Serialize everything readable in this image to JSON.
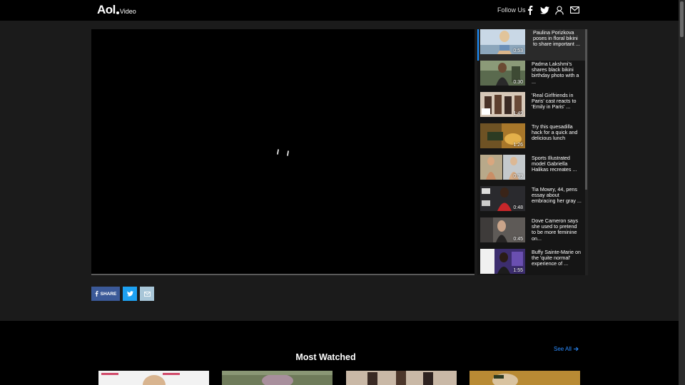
{
  "header": {
    "logo_main": "Aol",
    "logo_sub": "Video",
    "follow_label": "Follow Us"
  },
  "playlist": [
    {
      "title": "Paulina Porizkova poses in floral bikini to share important ...",
      "duration": "0:53",
      "active": true
    },
    {
      "title": "Padma Lakshmi's shares black bikini birthday photo with a ...",
      "duration": "0:30"
    },
    {
      "title": "'Real Girlfriends in Paris' cast reacts to 'Emily in Paris' ...",
      "duration": "1:49"
    },
    {
      "title": "Try this quesadilla hack for a quick and delicious lunch",
      "duration": "1:26"
    },
    {
      "title": "Sports Illustrated model Gabriella Halikas recreates ...",
      "duration": "0:39"
    },
    {
      "title": "Tia Mowry, 44, pens essay about embracing her gray ...",
      "duration": "0:48"
    },
    {
      "title": "Dove Cameron says she used to pretend to be more feminine on...",
      "duration": "0:45"
    },
    {
      "title": "Buffy Sainte-Marie on the 'quite normal' experience of ...",
      "duration": "1:55"
    }
  ],
  "share": {
    "facebook_label": "SHARE"
  },
  "most_watched": {
    "title": "Most Watched",
    "see_all": "See All"
  },
  "colors": {
    "accent": "#1a8fff",
    "facebook": "#3b5998",
    "twitter": "#1da1f2",
    "email": "#a8c6d8",
    "link": "#2b8cff"
  }
}
